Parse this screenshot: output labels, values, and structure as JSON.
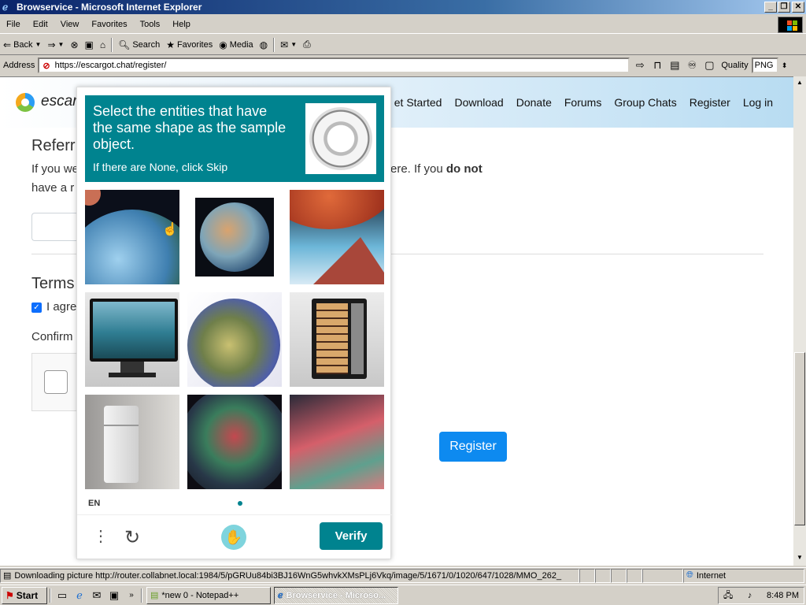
{
  "window": {
    "title": "Browservice - Microsoft Internet Explorer",
    "minimize": "_",
    "maximize": "❐",
    "close": "✕"
  },
  "menubar": [
    "File",
    "Edit",
    "View",
    "Favorites",
    "Tools",
    "Help"
  ],
  "toolbar": {
    "back": "Back",
    "search": "Search",
    "favorites": "Favorites",
    "media": "Media"
  },
  "addressbar": {
    "label": "Address",
    "url": "https://escargot.chat/register/",
    "quality_label": "Quality",
    "quality_value": "PNG"
  },
  "site": {
    "logo_text": "escar",
    "nav": [
      "et Started",
      "Download",
      "Donate",
      "Forums",
      "Group Chats",
      "Register",
      "Log in"
    ]
  },
  "page": {
    "referral_heading": "Referr",
    "referral_text_line1_a": "If you we",
    "referral_text_line1_b": "ere. If you ",
    "referral_text_line1_bold": "do not",
    "referral_text_line2": "have a r",
    "terms_heading": "Terms",
    "agree_label": "I agre",
    "confirm_label": "Confirm",
    "register_button": "Register"
  },
  "captcha": {
    "prompt": "Select the entities that have the same shape as the sample object.",
    "prompt_sub": "If there are None, click Skip",
    "language": "EN",
    "verify_button": "Verify",
    "tiles": [
      "planet-earth",
      "planet-earth",
      "red-planet",
      "computer-monitor",
      "planet-earth",
      "open-refrigerator",
      "refrigerator",
      "planet-earth",
      "planet-closeup"
    ]
  },
  "statusbar": {
    "text": "Downloading picture http://router.collabnet.local:1984/5/pGRUu84bi3BJ16WnG5whvkXMsPLj6Vkq/image/5/1671/0/1020/647/1028/MMO_262_",
    "zone": "Internet"
  },
  "taskbar": {
    "start": "Start",
    "tasks": [
      "*new  0 - Notepad++",
      "Browservice - Microso..."
    ],
    "clock": "8:48 PM"
  }
}
